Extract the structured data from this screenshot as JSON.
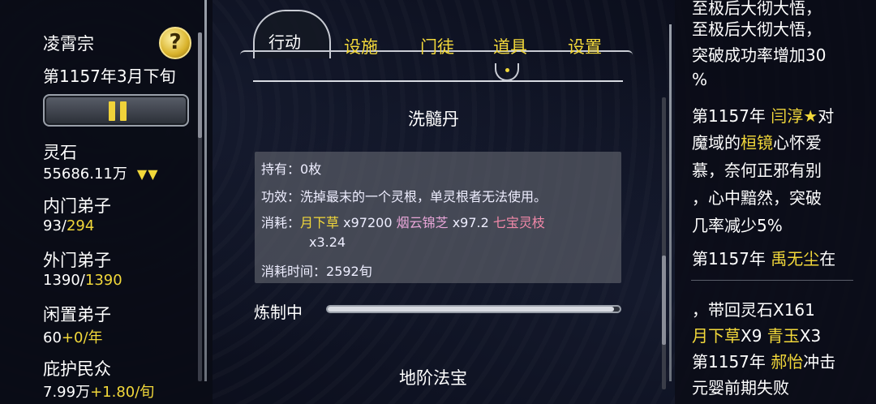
{
  "left": {
    "sect_name": "凌霄宗",
    "help_symbol": "?",
    "date": "第1157年3月下旬",
    "stats": [
      {
        "label": "灵石",
        "value": "55686.11万",
        "extra": "",
        "arrows": "▼▼"
      },
      {
        "label": "内门弟子",
        "value": "93/",
        "extra": "294",
        "arrows": ""
      },
      {
        "label": "外门弟子",
        "value": "1390/",
        "extra": "1390",
        "arrows": ""
      },
      {
        "label": "闲置弟子",
        "value": "60",
        "extra": "+0/年",
        "arrows": ""
      },
      {
        "label": "庇护民众",
        "value": "7.99万",
        "extra": "+1.80/旬",
        "arrows": ""
      }
    ]
  },
  "tabs": [
    {
      "label": "行动",
      "active": true
    },
    {
      "label": "设施",
      "active": false
    },
    {
      "label": "门徒",
      "active": false
    },
    {
      "label": "道具",
      "active": false
    },
    {
      "label": "设置",
      "active": false
    }
  ],
  "center": {
    "item_title": "洗髓丹",
    "held_label": "持有：",
    "held_value": "0枚",
    "effect_label": "功效：",
    "effect_value": "洗掉最末的一个灵根，单灵根者无法使用。",
    "cost_label": "消耗：",
    "costs": [
      {
        "name": "月下草",
        "qty": "x97200"
      },
      {
        "name": "烟云锦芝",
        "qty": "x97.2"
      },
      {
        "name": "七宝灵枝",
        "qty": "x3.24"
      }
    ],
    "time_label": "消耗时间：",
    "time_value": "2592旬",
    "craft_label": "炼制中",
    "craft_progress": 0.98,
    "next_item": "地阶法宝"
  },
  "log": {
    "line1": "至极后大彻大悟，",
    "line2": "突破成功率增加30",
    "line3": "%",
    "e2_year": "第1157年",
    "e2_name": "闫淳★",
    "e2_tail": "对",
    "e2_l2a": "魔域的",
    "e2_l2name": "桓镜",
    "e2_l2b": "心怀爱",
    "e2_l3": "慕，奈何正邪有别",
    "e2_l4": "，心中黯然，突破",
    "e2_l5": "几率减少5%",
    "e3_year": "第1157年",
    "e3_name": "禹无尘",
    "e3_tail": "在",
    "e3_l2": "，带回灵石X161",
    "e3_l3a": "月下草",
    "e3_l3b": "X9",
    "e3_l3c": "青玉",
    "e3_l3d": "X3",
    "e4_year": "第1157年",
    "e4_name": "郝怡",
    "e4_tail": "冲击",
    "e4_l2": "元婴前期失败"
  },
  "colors": {
    "accent_yellow": "#f2d83a",
    "pink": "#e8a6d8",
    "rose": "#f088a8"
  }
}
